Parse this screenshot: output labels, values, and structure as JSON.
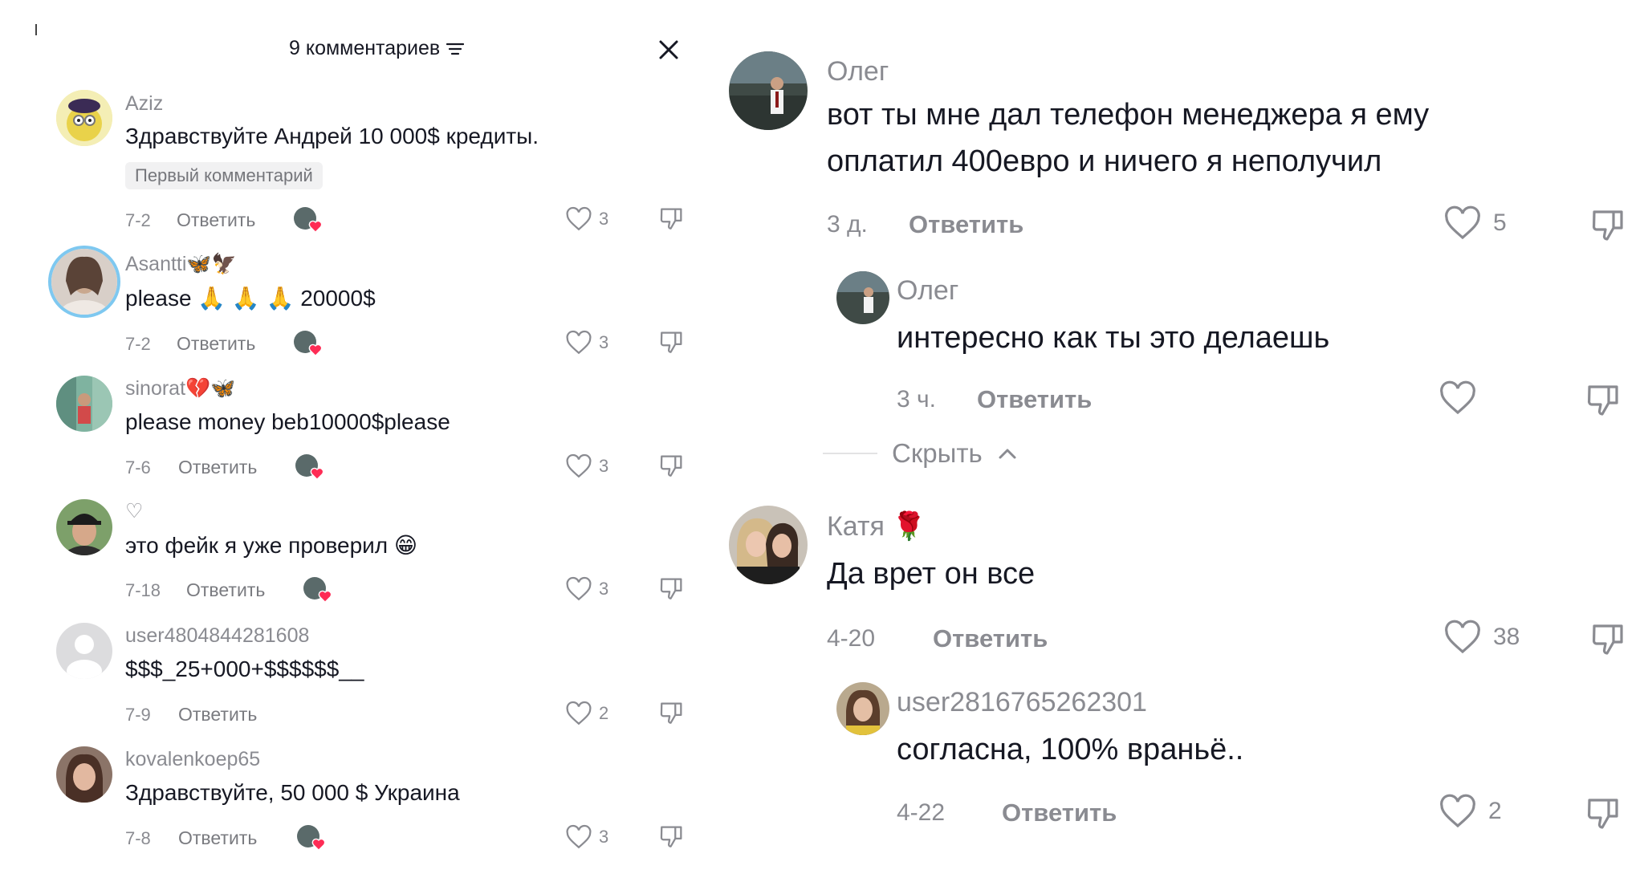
{
  "left": {
    "header": {
      "title": "9 комментариев",
      "sort_icon": "sort-lines-icon",
      "close_icon": "close-icon"
    },
    "comments": [
      {
        "username": "Aziz",
        "text": "Здравствуйте Андрей 10 000$ кредиты.",
        "badge": "Первый комментарий",
        "date": "7-2",
        "reply": "Ответить",
        "likes": "3"
      },
      {
        "username": "Asantti🦋🦅",
        "text": "please 🙏 🙏 🙏 20000$",
        "date": "7-2",
        "reply": "Ответить",
        "likes": "3"
      },
      {
        "username": "sinorat💔🦋",
        "text": "please money beb10000$please",
        "date": "7-6",
        "reply": "Ответить",
        "likes": "3"
      },
      {
        "username": "♡",
        "text": "это фейк я уже проверил 😁",
        "date": "7-18",
        "reply": "Ответить",
        "likes": "3"
      },
      {
        "username": "user4804844281608",
        "text": "$$$_25+000+$$$$$$__",
        "date": "7-9",
        "reply": "Ответить",
        "likes": "2"
      },
      {
        "username": "kovalenkoep65",
        "text": "Здравствуйте, 50 000 $ Украина",
        "date": "7-8",
        "reply": "Ответить",
        "likes": "3"
      }
    ]
  },
  "right": {
    "comments": [
      {
        "username": "Олег",
        "text_line1": "вот ты мне дал телефон менеджера я ему",
        "text_line2": "оплатил 400евро и ничего я неполучил",
        "date": "3 д.",
        "reply": "Ответить",
        "likes": "5"
      },
      {
        "username": "Олег",
        "text": "интересно как ты это делаешь",
        "date": "3 ч.",
        "reply": "Ответить",
        "likes": ""
      },
      {
        "username": "Катя 🌹",
        "text": "Да врет он все",
        "date": "4-20",
        "reply": "Ответить",
        "likes": "38"
      },
      {
        "username": "user2816765262301",
        "text": "согласна, 100% враньё..",
        "date": "4-22",
        "reply": "Ответить",
        "likes": "2"
      }
    ],
    "hide_label": "Скрыть"
  },
  "colors": {
    "text": "#161823",
    "muted": "#8a8b91",
    "badge_bg": "#f1f1f2",
    "ring": "#7ec8f0",
    "heart_red": "#fe2c55"
  }
}
